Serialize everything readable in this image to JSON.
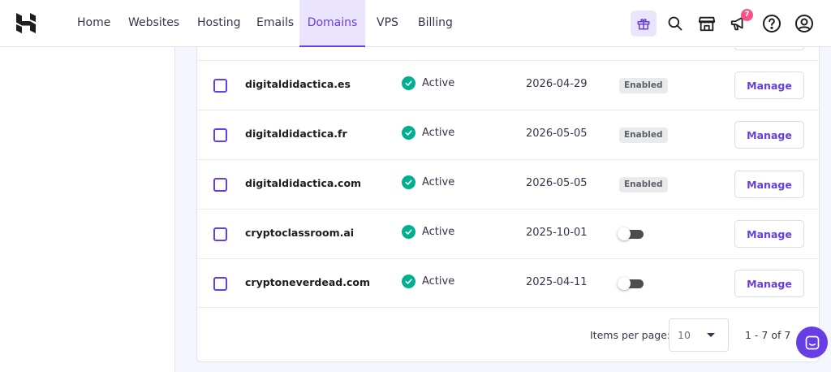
{
  "nav": {
    "items": [
      {
        "label": "Home"
      },
      {
        "label": "Websites"
      },
      {
        "label": "Hosting"
      },
      {
        "label": "Emails"
      },
      {
        "label": "Domains",
        "active": true
      },
      {
        "label": "VPS"
      },
      {
        "label": "Billing"
      }
    ],
    "notification_count": "7",
    "icons": [
      "gift-icon",
      "search-icon",
      "store-icon",
      "megaphone-icon",
      "help-icon",
      "account-icon"
    ]
  },
  "table": {
    "rows": [
      {
        "domain": "digitaldidactica.es",
        "status": "Active",
        "expires": "2026-04-29",
        "auto_renew": "Enabled",
        "action": "Manage"
      },
      {
        "domain": "digitaldidactica.fr",
        "status": "Active",
        "expires": "2026-05-05",
        "auto_renew": "Enabled",
        "action": "Manage"
      },
      {
        "domain": "digitaldidactica.com",
        "status": "Active",
        "expires": "2026-05-05",
        "auto_renew": "Enabled",
        "action": "Manage"
      },
      {
        "domain": "cryptoclassroom.ai",
        "status": "Active",
        "expires": "2025-10-01",
        "auto_renew": "off",
        "action": "Manage"
      },
      {
        "domain": "cryptoneverdead.com",
        "status": "Active",
        "expires": "2025-04-11",
        "auto_renew": "off",
        "action": "Manage"
      }
    ]
  },
  "pagination": {
    "items_per_page_label": "Items per page:",
    "items_per_page_value": "10",
    "range_text": "1 - 7 of 7"
  },
  "colors": {
    "accent": "#673de6",
    "active_status": "#00b090",
    "badge": "#fc5185"
  }
}
